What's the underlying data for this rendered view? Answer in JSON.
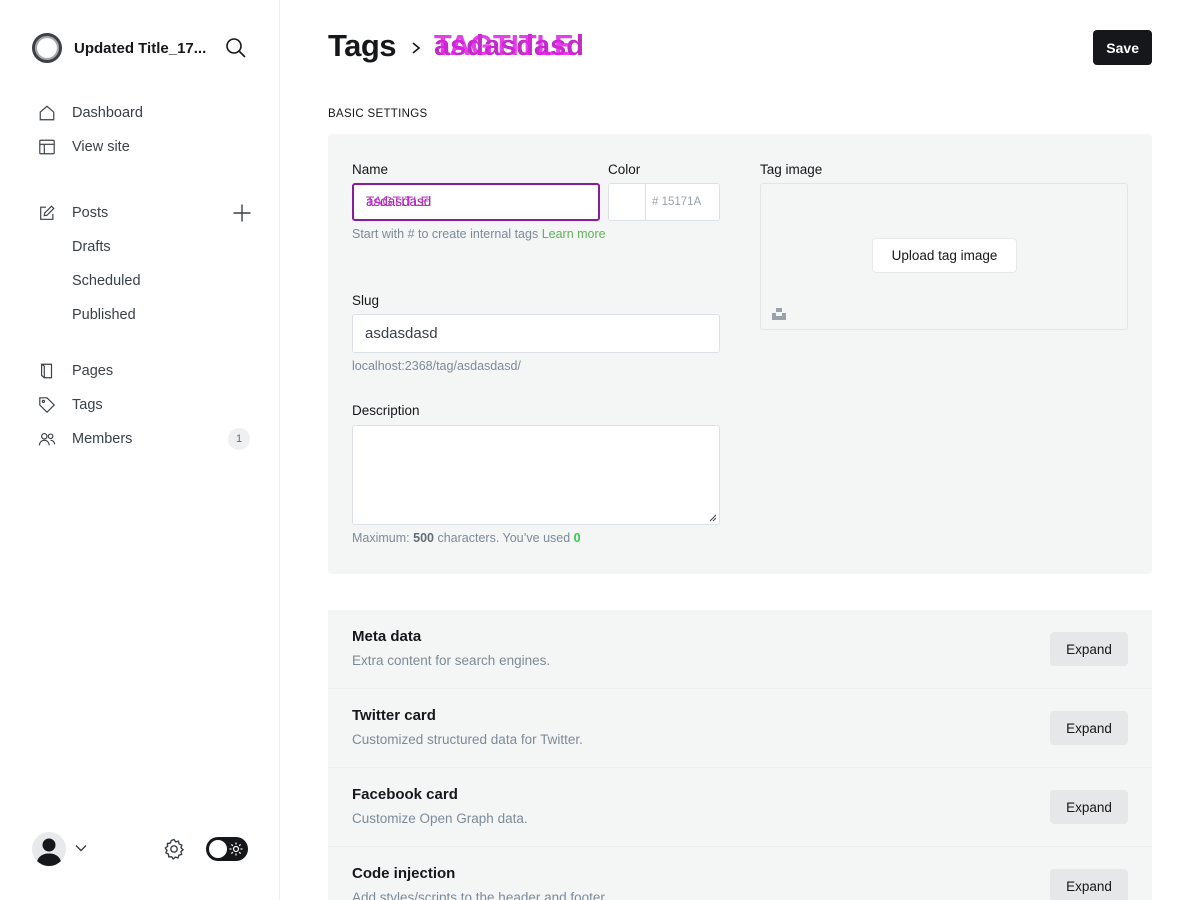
{
  "sidebar": {
    "site_title": "Updated Title_17...",
    "nav": [
      {
        "label": "Dashboard",
        "icon": "home-icon"
      },
      {
        "label": "View site",
        "icon": "view-site-icon"
      }
    ],
    "posts": {
      "label": "Posts",
      "sub": [
        {
          "label": "Drafts"
        },
        {
          "label": "Scheduled"
        },
        {
          "label": "Published"
        }
      ]
    },
    "nav2": [
      {
        "label": "Pages",
        "icon": "pages-icon"
      },
      {
        "label": "Tags",
        "icon": "tag-icon"
      },
      {
        "label": "Members",
        "icon": "members-icon",
        "count": "1"
      }
    ]
  },
  "header": {
    "breadcrumb_parent": "Tags",
    "breadcrumb_current": "asdasdasd",
    "breadcrumb_overlay": "TAGTITLE",
    "save_label": "Save"
  },
  "basic": {
    "section_label": "BASIC SETTINGS",
    "name_label": "Name",
    "name_value": "asdasdasd",
    "name_overlay": "TAGTITLE",
    "color_label": "Color",
    "color_placeholder": "# 15171A",
    "name_hint": "Start with # to create internal tags ",
    "name_hint_link": "Learn more",
    "tag_image_label": "Tag image",
    "upload_label": "Upload tag image",
    "slug_label": "Slug",
    "slug_value": "asdasdasd",
    "slug_url": "localhost:2368/tag/asdasdasd/",
    "description_label": "Description",
    "description_value": "",
    "desc_hint_prefix": "Maximum: ",
    "desc_hint_max": "500",
    "desc_hint_mid": " characters. You’ve used ",
    "desc_hint_used": "0"
  },
  "sections": [
    {
      "title": "Meta data",
      "desc": "Extra content for search engines.",
      "button": "Expand"
    },
    {
      "title": "Twitter card",
      "desc": "Customized structured data for Twitter.",
      "button": "Expand"
    },
    {
      "title": "Facebook card",
      "desc": "Customize Open Graph data.",
      "button": "Expand"
    },
    {
      "title": "Code injection",
      "desc": "Add styles/scripts to the header and footer.",
      "button": "Expand"
    }
  ],
  "colors": {
    "accent": "#15171a",
    "overlay_magenta": "#e01fe6",
    "link_green": "#30cf43"
  }
}
